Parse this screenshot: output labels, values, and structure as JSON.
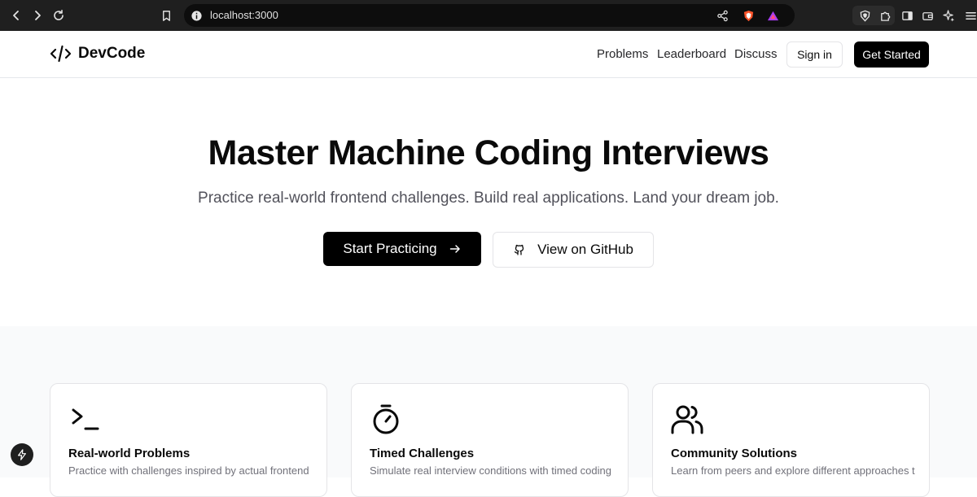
{
  "browser": {
    "url": "localhost:3000"
  },
  "header": {
    "logo_text": "DevCode",
    "nav": [
      "Problems",
      "Leaderboard",
      "Discuss"
    ],
    "signin_label": "Sign in",
    "get_started_label": "Get Started"
  },
  "hero": {
    "title": "Master Machine Coding Interviews",
    "subtitle": "Practice real-world frontend challenges. Build real applications. Land your dream job.",
    "primary_label": "Start Practicing",
    "secondary_label": "View on GitHub"
  },
  "features": [
    {
      "icon": "terminal-icon",
      "title": "Real-world Problems",
      "description": "Practice with challenges inspired by actual frontend"
    },
    {
      "icon": "timer-icon",
      "title": "Timed Challenges",
      "description": "Simulate real interview conditions with timed coding"
    },
    {
      "icon": "users-icon",
      "title": "Community Solutions",
      "description": "Learn from peers and explore different approaches to"
    }
  ],
  "colors": {
    "chrome_bg": "#1f1f1f",
    "primary": "#000000",
    "muted_text": "#52525b",
    "features_bg": "#f9fafb"
  }
}
